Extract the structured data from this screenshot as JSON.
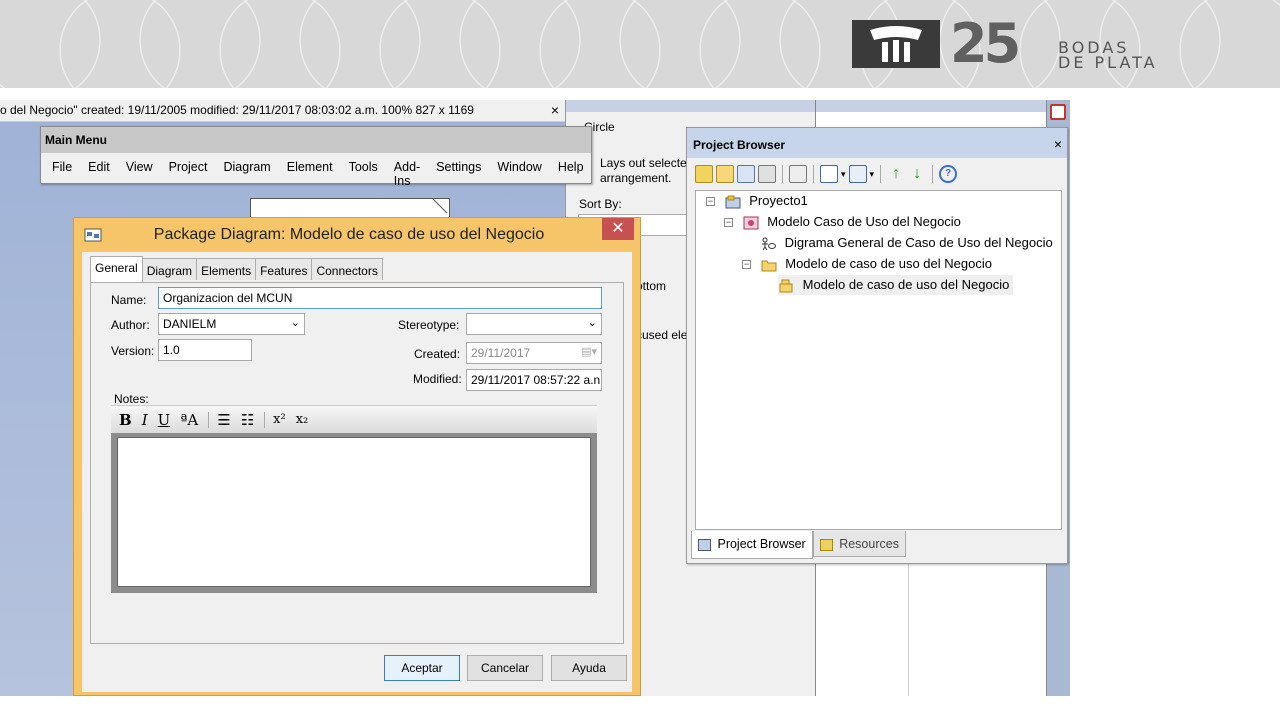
{
  "banner": {
    "logo_number": "25",
    "logo_line1": "BODAS",
    "logo_line2": "DE PLATA"
  },
  "status_bar": {
    "text": "o del Negocio\"   created: 19/11/2005  modified: 29/11/2017 08:03:02 a.m.   100%   827 x 1169",
    "close": "×"
  },
  "layout_palette": {
    "circle_label": "Circle",
    "description_line1": "Lays out selectec",
    "description_line2": "arrangement.",
    "sort_by": "Sort By:",
    "fragment_bottom": "ottom",
    "fragment_focused": "cused ele"
  },
  "main_menu": {
    "title": "Main Menu",
    "items": [
      "File",
      "Edit",
      "View",
      "Project",
      "Diagram",
      "Element",
      "Tools",
      "Add-Ins",
      "Settings",
      "Window",
      "Help"
    ]
  },
  "dialog": {
    "title": "Package Diagram: Modelo de caso de uso del Negocio",
    "close": "✕",
    "tabs": [
      "General",
      "Diagram",
      "Elements",
      "Features",
      "Connectors"
    ],
    "name_label": "Name:",
    "name_value": "Organizacion del MCUN",
    "author_label": "Author:",
    "author_value": "DANIELM",
    "version_label": "Version:",
    "version_value": "1.0",
    "stereotype_label": "Stereotype:",
    "stereotype_value": "",
    "created_label": "Created:",
    "created_value": "29/11/2017",
    "modified_label": "Modified:",
    "modified_value": "29/11/2017 08:57:22 a.n",
    "notes_label": "Notes:",
    "toolbar": {
      "bold": "B",
      "italic": "I",
      "underline": "U",
      "font_color": "ªA",
      "bullets": "☰",
      "numbering": "☷",
      "superscript": "x²",
      "subscript": "x₂"
    },
    "buttons": {
      "ok": "Aceptar",
      "cancel": "Cancelar",
      "help": "Ayuda"
    }
  },
  "project_browser": {
    "title": "Project Browser",
    "close": "×",
    "tree": [
      {
        "label": "Proyecto1"
      },
      {
        "label": "Modelo Caso de Uso del Negocio"
      },
      {
        "label": "Digrama General de Caso de Uso del Negocio"
      },
      {
        "label": "Modelo de caso de uso del Negocio"
      },
      {
        "label": "Modelo de caso de uso del Negocio"
      }
    ],
    "tabs": [
      "Project Browser",
      "Resources"
    ]
  },
  "colors": {
    "dialog_frame": "#f6c56a",
    "dialog_close": "#c75050",
    "browser_title": "#c6d5ea"
  }
}
